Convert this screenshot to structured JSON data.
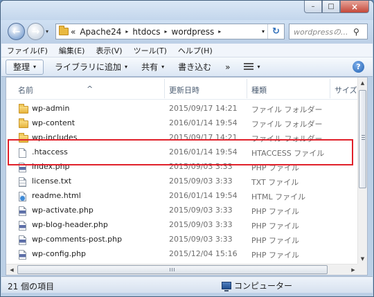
{
  "window": {
    "caption_buttons": {
      "minimize": "–",
      "maximize": "□",
      "close": "×"
    }
  },
  "nav": {
    "back": "←",
    "forward": "→",
    "history_dropdown": "▾",
    "breadcrumb_overflow": "«",
    "breadcrumbs": [
      "Apache24",
      "htdocs",
      "wordpress"
    ],
    "crumb_separator": "▸",
    "address_dropdown": "▾",
    "refresh": "↻",
    "search_placeholder": "wordpressの...",
    "search_icon": "⚲"
  },
  "menu": [
    "ファイル(F)",
    "編集(E)",
    "表示(V)",
    "ツール(T)",
    "ヘルプ(H)"
  ],
  "commands": {
    "organize": "整理",
    "library": "ライブラリに追加",
    "share": "共有",
    "burn": "書き込む",
    "more": "»",
    "help": "?",
    "dropdown_arrow": "▾"
  },
  "columns": {
    "name": "名前",
    "modified": "更新日時",
    "type": "種類",
    "size": "サイズ",
    "sort_indicator": "^"
  },
  "files": [
    {
      "icon": "folder-icon",
      "name": "wp-admin",
      "modified": "2015/09/17 14:21",
      "type": "ファイル フォルダー"
    },
    {
      "icon": "folder-icon",
      "name": "wp-content",
      "modified": "2016/01/14 19:54",
      "type": "ファイル フォルダー"
    },
    {
      "icon": "folder-icon",
      "name": "wp-includes",
      "modified": "2015/09/17 14:21",
      "type": "ファイル フォルダー"
    },
    {
      "icon": "file-icon",
      "name": ".htaccess",
      "modified": "2016/01/14 19:54",
      "type": "HTACCESS ファイル"
    },
    {
      "icon": "php-file-icon",
      "name": "index.php",
      "modified": "2015/09/03 3:33",
      "type": "PHP ファイル"
    },
    {
      "icon": "text-file-icon",
      "name": "license.txt",
      "modified": "2015/09/03 3:33",
      "type": "TXT ファイル"
    },
    {
      "icon": "html-file-icon",
      "name": "readme.html",
      "modified": "2016/01/14 19:54",
      "type": "HTML ファイル"
    },
    {
      "icon": "php-file-icon",
      "name": "wp-activate.php",
      "modified": "2015/09/03 3:33",
      "type": "PHP ファイル"
    },
    {
      "icon": "php-file-icon",
      "name": "wp-blog-header.php",
      "modified": "2015/09/03 3:33",
      "type": "PHP ファイル"
    },
    {
      "icon": "php-file-icon",
      "name": "wp-comments-post.php",
      "modified": "2015/09/03 3:33",
      "type": "PHP ファイル"
    },
    {
      "icon": "php-file-icon",
      "name": "wp-config.php",
      "modified": "2015/12/04 15:16",
      "type": "PHP ファイル"
    }
  ],
  "scrollbars": {
    "up": "▲",
    "down": "▼",
    "left": "◀",
    "right": "▶"
  },
  "status": {
    "item_count": "21 個の項目",
    "location": "コンピューター"
  },
  "colors": {
    "highlight_border": "#e0202a",
    "secondary_text": "#6d6d6d",
    "chrome_blue": "#bcd0e6"
  }
}
